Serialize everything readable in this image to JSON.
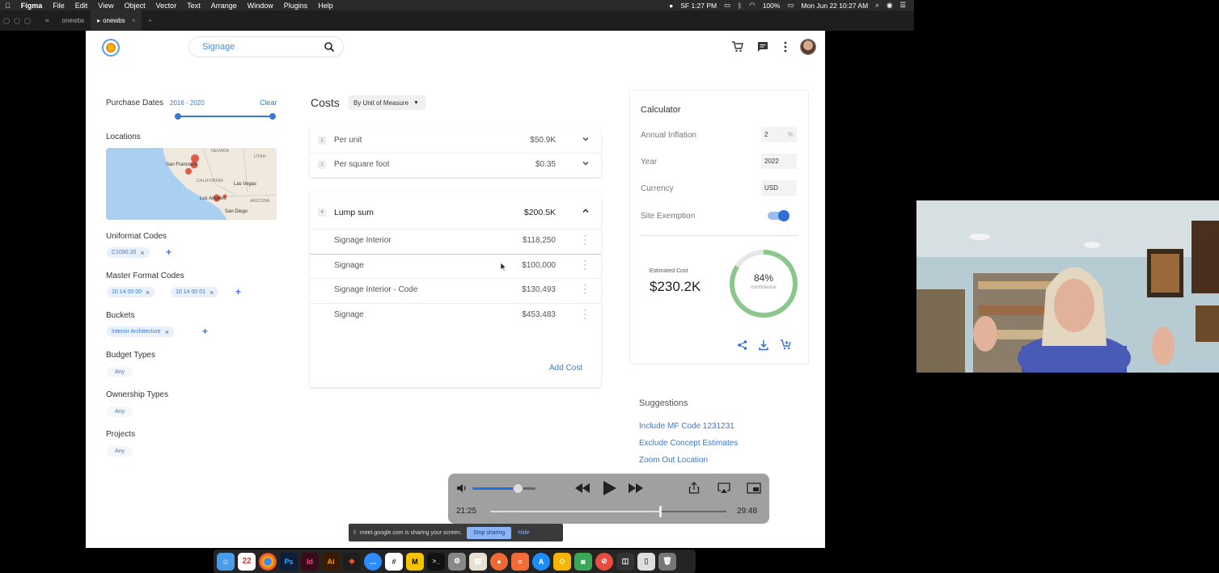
{
  "menubar": {
    "app": "Figma",
    "items": [
      "File",
      "Edit",
      "View",
      "Object",
      "Vector",
      "Text",
      "Arrange",
      "Window",
      "Plugins",
      "Help"
    ],
    "status": {
      "sf_time": "SF 1:27 PM",
      "battery": "100%",
      "datetime": "Mon Jun 22  10:27 AM"
    }
  },
  "tabs": [
    "onewbs",
    "onewbs"
  ],
  "header": {
    "search_value": "Signage"
  },
  "filters": {
    "purchase_dates_label": "Purchase Dates",
    "purchase_dates_range": "2016 - 2020",
    "clear_label": "Clear",
    "locations_label": "Locations",
    "map_labels": [
      "NEVADA",
      "UTAH",
      "San Francisco",
      "CALIFORNIA",
      "Las Vegas",
      "Los Angeles",
      "ARIZONA",
      "San Diego"
    ],
    "uniformat_label": "Uniformat Codes",
    "uniformat_chip": "C1090.20",
    "master_format_label": "Master Format Codes",
    "master_format_chips": [
      "10 14 00 00",
      "10 14 00 01"
    ],
    "buckets_label": "Buckets",
    "bucket_chip": "Interior Architecture",
    "budget_types_label": "Budget Types",
    "budget_types_value": "Any",
    "ownership_types_label": "Ownership Types",
    "ownership_types_value": "Any",
    "projects_label": "Projects",
    "projects_value": "Any"
  },
  "costs": {
    "title": "Costs",
    "uom_dropdown": "By Unit of Measure",
    "summary_rows": [
      {
        "num": "1",
        "label": "Per unit",
        "value": "$50.9K"
      },
      {
        "num": "1",
        "label": "Per square foot",
        "value": "$0.35"
      }
    ],
    "lump": {
      "num": "4",
      "label": "Lump sum",
      "value": "$200.5K"
    },
    "line_items": [
      {
        "label": "Signage Interior",
        "value": "$118,250"
      },
      {
        "label": "Signage",
        "value": "$100,000"
      },
      {
        "label": "Signage Interior - Code",
        "value": "$130,493"
      },
      {
        "label": "Signage",
        "value": "$453,483"
      }
    ],
    "add_cost": "Add Cost"
  },
  "calculator": {
    "title": "Calculator",
    "annual_inflation_label": "Annual Inflation",
    "annual_inflation_value": "2",
    "percent": "%",
    "year_label": "Year",
    "year_value": "2022",
    "currency_label": "Currency",
    "currency_value": "USD",
    "site_exemption_label": "Site Exemption",
    "site_exemption_on": true,
    "estimated_cost_label": "Estimated Cost",
    "estimated_cost_value": "$230.2K",
    "confidence_pct": "84%",
    "confidence_label": "confidence",
    "confidence_fraction": 0.84
  },
  "suggestions": {
    "title": "Suggestions",
    "items": [
      "Include MF Code 1231231",
      "Exclude Concept Estimates",
      "Zoom Out Location"
    ]
  },
  "video": {
    "elapsed": "21:25",
    "total": "29:48",
    "progress": 0.72,
    "volume": 0.72
  },
  "sharing": {
    "message": "meet.google.com is sharing your screen.",
    "stop": "Stop sharing",
    "hide": "Hide"
  },
  "colors": {
    "accent": "#3a78d0",
    "confidence_ring": "#8bc78a"
  }
}
